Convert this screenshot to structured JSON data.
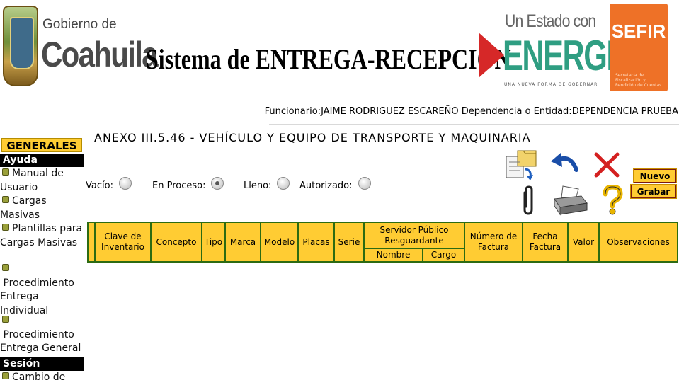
{
  "header": {
    "gob_line1": "Gobierno de",
    "gob_line2": "Coahuila",
    "system_title": "Sistema de ENTREGA-RECEPCIÓN",
    "estado_line1": "Un Estado con",
    "estado_line2": "ENERGIA",
    "estado_sub": "UNA NUEVA FORMA DE GOBERNAR",
    "sefir": "SEFIR",
    "sefir_sub": "Secretaría de Fiscalización y Rendición de Cuentas"
  },
  "user_info": {
    "funcionario_label": "Funcionario:",
    "funcionario_value": "JAIME RODRIGUEZ ESCAREÑO",
    "dependencia_label": " Dependencia o Entidad:",
    "dependencia_value": "DEPENDENCIA PRUEBA"
  },
  "sidebar": {
    "generales": "GENERALES",
    "ayuda": "Ayuda",
    "items": [
      {
        "label": "Manual de Usuario"
      },
      {
        "label": "Cargas Masivas"
      },
      {
        "label": "Plantillas para Cargas Masivas"
      },
      {
        "label": "Procedimiento Entrega Individual"
      },
      {
        "label": "Procedimiento Entrega General"
      }
    ],
    "sesion": "Sesión",
    "sesion_items": [
      {
        "label": "Cambio de"
      }
    ]
  },
  "page_title": "ANEXO III.5.46 - VEHÍCULO Y EQUIPO DE TRANSPORTE Y MAQUINARIA",
  "status": {
    "vacio": "Vacío:",
    "en_proceso": "En Proceso:",
    "lleno": "Lleno:",
    "autorizado": "Autorizado:",
    "selected": "en_proceso"
  },
  "buttons": {
    "nuevo": "Nuevo",
    "grabar": "Grabar"
  },
  "icons": [
    "file-transfer-icon",
    "undo-icon",
    "close-icon",
    "paperclip-icon",
    "printer-icon",
    "help-icon"
  ],
  "table": {
    "headers": {
      "clave": "Clave de Inventario",
      "concepto": "Concepto",
      "tipo": "Tipo",
      "marca": "Marca",
      "modelo": "Modelo",
      "placas": "Placas",
      "serie": "Serie",
      "servidor": "Servidor Público Resguardante",
      "nombre": "Nombre",
      "cargo": "Cargo",
      "numero_factura": "Número de Factura",
      "fecha_factura": "Fecha Factura",
      "valor": "Valor",
      "observaciones": "Observaciones"
    },
    "rows": []
  },
  "colors": {
    "accent": "#ffcc33",
    "table_border": "#2c6b12",
    "sidebar_black": "#000000",
    "energia_green": "#2f9e82",
    "sefir_orange": "#ee7127"
  }
}
